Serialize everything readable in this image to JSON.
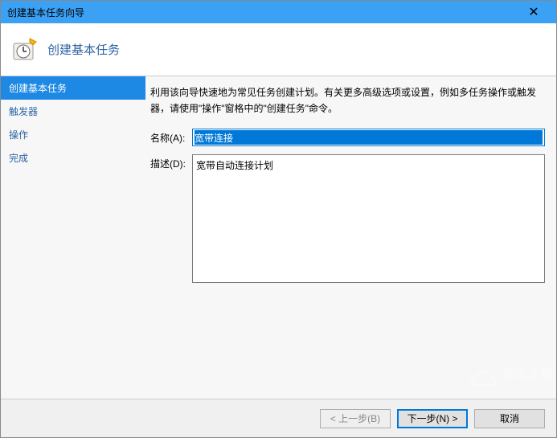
{
  "titlebar": {
    "title": "创建基本任务向导"
  },
  "header": {
    "title": "创建基本任务"
  },
  "sidebar": {
    "items": [
      {
        "label": "创建基本任务",
        "selected": true
      },
      {
        "label": "触发器",
        "selected": false
      },
      {
        "label": "操作",
        "selected": false
      },
      {
        "label": "完成",
        "selected": false
      }
    ]
  },
  "content": {
    "description": "利用该向导快速地为常见任务创建计划。有关更多高级选项或设置，例如多任务操作或触发器，请使用\"操作\"窗格中的\"创建任务\"命令。",
    "name_label": "名称(A):",
    "name_value": "宽带连接",
    "desc_label": "描述(D):",
    "desc_value": "宽带自动连接计划"
  },
  "footer": {
    "back_label": "< 上一步(B)",
    "next_label": "下一步(N) >",
    "cancel_label": "取消"
  },
  "watermark": {
    "text": "系统之家"
  }
}
